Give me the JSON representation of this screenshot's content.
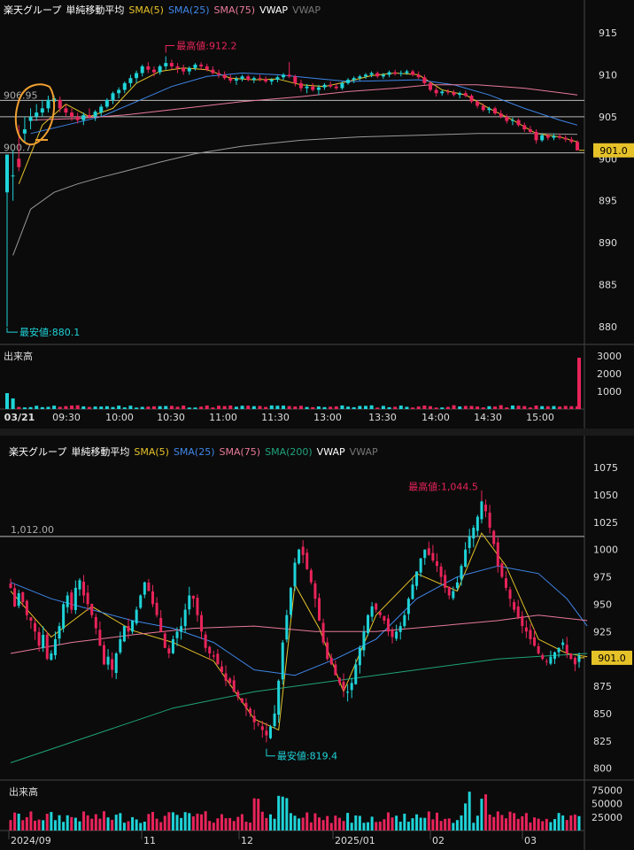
{
  "colors": {
    "sma5": "#e6c229",
    "sma25": "#3f86e8",
    "sma75": "#e87a9a",
    "sma200": "#1fa37a",
    "vwap": "#dddddd",
    "vwap_muted": "#777777",
    "up": "#1fd3d8",
    "down": "#e8245a",
    "price_box": "#e6c229",
    "annot": "#e8245a",
    "annot_low": "#1fd3d8",
    "circle": "#f0a030"
  },
  "intraday": {
    "legend": {
      "name": "楽天グループ",
      "avg": "単純移動平均",
      "sma5": "SMA(5)",
      "sma25": "SMA(25)",
      "sma75": "SMA(75)",
      "vwap": "VWAP",
      "vwap2": "VWAP"
    },
    "volume_title": "出来高",
    "high_label": "最高値:912.2",
    "low_label": "最安値:880.1",
    "ref1_label": "906.95",
    "ref2_label": "900.7",
    "price_label": "901.0"
  },
  "daily": {
    "legend": {
      "name": "楽天グループ",
      "avg": "単純移動平均",
      "sma5": "SMA(5)",
      "sma25": "SMA(25)",
      "sma75": "SMA(75)",
      "sma200": "SMA(200)",
      "vwap": "VWAP",
      "vwap2": "VWAP"
    },
    "volume_title": "出来高",
    "high_label": "最高値:1,044.5",
    "low_label": "最安値:819.4",
    "ref_label": "1,012.00",
    "price_label": "901.0"
  },
  "chart_data": [
    {
      "type": "candlestick",
      "title": "楽天グループ",
      "period": "intraday 03/21",
      "x_ticks": [
        "03/21",
        "09:30",
        "10:00",
        "10:30",
        "11:00",
        "11:30",
        "13:00",
        "13:30",
        "14:00",
        "14:30",
        "15:00"
      ],
      "y_ticks": [
        880,
        885,
        890,
        895,
        900,
        905,
        910,
        915
      ],
      "ylim": [
        878,
        917
      ],
      "volume_ticks": [
        1000,
        2000,
        3000
      ],
      "volume_ylim": [
        0,
        3300
      ],
      "last_price": 901.0,
      "high": 912.2,
      "low": 880.1,
      "ref_lines": [
        906.95,
        905.0,
        900.7
      ],
      "candles": [
        [
          0,
          896,
          898,
          880,
          900.5
        ],
        [
          1,
          898,
          901,
          895,
          898
        ],
        [
          2,
          900,
          904,
          898.5,
          899
        ],
        [
          3,
          903,
          905,
          902,
          903.5
        ],
        [
          4,
          904.5,
          906,
          903.5,
          905
        ],
        [
          5,
          905,
          906.5,
          904.5,
          905.5
        ],
        [
          6,
          905.5,
          907,
          905,
          906
        ],
        [
          7,
          906,
          907.5,
          905.5,
          907
        ],
        [
          8,
          906.8,
          907.5,
          906,
          907.2
        ],
        [
          9,
          907,
          907.4,
          905.5,
          906
        ],
        [
          10,
          906,
          906.5,
          905,
          905.5
        ],
        [
          11,
          905.5,
          906,
          904.5,
          905
        ],
        [
          12,
          905,
          905.5,
          904.2,
          904.6
        ],
        [
          13,
          904.6,
          905.5,
          904,
          905.2
        ],
        [
          14,
          905.2,
          906,
          904.8,
          905
        ],
        [
          15,
          905,
          905.8,
          904.5,
          905.6
        ],
        [
          16,
          905.5,
          906.5,
          905,
          906.2
        ],
        [
          17,
          906.2,
          907.2,
          906,
          907
        ],
        [
          18,
          907,
          908,
          906.5,
          907.8
        ],
        [
          19,
          907.8,
          908.5,
          907.2,
          908.2
        ],
        [
          20,
          908.2,
          909.2,
          907.8,
          909
        ],
        [
          21,
          909,
          910,
          908.5,
          909.6
        ],
        [
          22,
          909.6,
          910.5,
          909,
          910.2
        ],
        [
          23,
          910.2,
          911.2,
          909.8,
          911
        ],
        [
          24,
          911,
          911.5,
          910.2,
          910.6
        ],
        [
          25,
          910.6,
          911,
          909.8,
          910.3
        ],
        [
          26,
          910.3,
          911.2,
          910,
          911
        ],
        [
          27,
          911,
          912.2,
          910.6,
          911.4
        ],
        [
          28,
          911.4,
          911.8,
          910.6,
          911
        ],
        [
          29,
          911,
          911.4,
          910.2,
          910.8
        ],
        [
          30,
          910.8,
          911.2,
          910,
          910.4
        ],
        [
          31,
          910.4,
          911,
          910,
          910.8
        ],
        [
          32,
          910.8,
          911.4,
          910.5,
          911.2
        ],
        [
          33,
          911.2,
          911.5,
          910.6,
          911
        ],
        [
          34,
          911,
          911.3,
          910.4,
          910.6
        ],
        [
          35,
          910.6,
          911,
          910,
          910.2
        ],
        [
          36,
          910.2,
          910.6,
          909.6,
          910
        ],
        [
          37,
          910,
          910.4,
          909.4,
          909.6
        ],
        [
          38,
          909.6,
          910,
          909,
          909.3
        ],
        [
          39,
          909.3,
          909.8,
          908.8,
          909.5
        ],
        [
          40,
          909.5,
          910,
          909.2,
          909.8
        ],
        [
          41,
          909.8,
          910,
          909.2,
          909.4
        ],
        [
          42,
          909.4,
          909.8,
          909,
          909.6
        ],
        [
          43,
          909.6,
          910,
          909.2,
          909.5
        ],
        [
          44,
          909.5,
          909.8,
          909,
          909.2
        ],
        [
          45,
          909.2,
          909.6,
          908.8,
          909.4
        ],
        [
          46,
          909.4,
          909.9,
          909.1,
          909.7
        ],
        [
          47,
          909.7,
          910.2,
          909.4,
          910
        ],
        [
          48,
          910,
          911.5,
          909.6,
          909.8
        ],
        [
          49,
          909.8,
          910,
          908.6,
          909
        ],
        [
          50,
          909,
          909.4,
          908,
          908.4
        ],
        [
          51,
          908.4,
          908.9,
          907.8,
          908.6
        ],
        [
          52,
          908.6,
          909,
          908,
          908.2
        ],
        [
          53,
          908.2,
          908.8,
          907.6,
          908.5
        ],
        [
          54,
          908.5,
          909,
          908.2,
          908.8
        ],
        [
          55,
          908.8,
          909.2,
          908.4,
          908.6
        ],
        [
          56,
          908.6,
          909,
          908.2,
          908.4
        ],
        [
          57,
          908.4,
          909.2,
          908.2,
          909
        ],
        [
          58,
          909,
          909.6,
          908.8,
          909.4
        ],
        [
          59,
          909.4,
          909.8,
          909,
          909.6
        ],
        [
          60,
          909.6,
          910,
          909.3,
          909.8
        ],
        [
          61,
          909.8,
          910.2,
          909.5,
          910
        ],
        [
          62,
          910,
          910.4,
          909.7,
          910.2
        ],
        [
          63,
          910.2,
          910.4,
          909.6,
          909.8
        ],
        [
          64,
          909.8,
          910.2,
          909.5,
          910
        ],
        [
          65,
          910,
          910.5,
          909.7,
          910.3
        ],
        [
          66,
          910.3,
          910.6,
          909.9,
          910.1
        ],
        [
          67,
          910.1,
          910.5,
          909.8,
          910.2
        ],
        [
          68,
          910.2,
          910.6,
          910,
          910.4
        ],
        [
          69,
          910.4,
          910.6,
          909.8,
          910
        ],
        [
          70,
          910,
          910.4,
          909.5,
          909.7
        ],
        [
          71,
          909.7,
          910,
          908.8,
          909
        ],
        [
          72,
          909,
          909.2,
          908,
          908.2
        ],
        [
          73,
          908.2,
          908.5,
          907.4,
          907.8
        ],
        [
          74,
          907.8,
          908.2,
          907.5,
          908
        ],
        [
          75,
          908,
          908.3,
          907.6,
          907.9
        ],
        [
          76,
          907.9,
          908.2,
          907.4,
          907.6
        ],
        [
          77,
          907.6,
          908,
          907.2,
          907.8
        ],
        [
          78,
          907.8,
          908.1,
          907.3,
          907.5
        ],
        [
          79,
          907.5,
          907.7,
          906.6,
          906.8
        ],
        [
          80,
          906.8,
          907,
          906,
          906.3
        ],
        [
          81,
          906.3,
          906.6,
          905.6,
          905.8
        ],
        [
          82,
          905.8,
          906.2,
          905.4,
          906
        ],
        [
          83,
          906,
          906.2,
          905.2,
          905.4
        ],
        [
          84,
          905.4,
          905.8,
          904.8,
          905
        ],
        [
          85,
          905,
          905.3,
          904.2,
          904.5
        ],
        [
          86,
          904.5,
          904.9,
          904,
          904.6
        ],
        [
          87,
          904.6,
          904.8,
          903.8,
          904
        ],
        [
          88,
          904,
          904.3,
          903.2,
          903.5
        ],
        [
          89,
          903.5,
          903.9,
          903,
          903.2
        ],
        [
          90,
          903.2,
          903.5,
          901.8,
          902.2
        ],
        [
          91,
          902.2,
          903,
          902,
          902.8
        ],
        [
          92,
          902.8,
          903,
          902.2,
          902.5
        ],
        [
          93,
          902.5,
          903,
          902.2,
          902.7
        ],
        [
          94,
          902.7,
          903,
          902.3,
          902.5
        ],
        [
          95,
          902.5,
          902.8,
          902,
          902.3
        ],
        [
          96,
          902.3,
          902.6,
          901.8,
          902
        ],
        [
          97,
          902,
          902.2,
          901,
          901
        ]
      ],
      "series": [
        {
          "name": "SMA(5)",
          "x": [
            2,
            6,
            10,
            14,
            18,
            22,
            26,
            30,
            34,
            38,
            42,
            46,
            50,
            54,
            58,
            62,
            66,
            70,
            74,
            78,
            82,
            86,
            90,
            94,
            97
          ],
          "values": [
            897,
            904,
            906.5,
            905,
            906,
            909,
            910.4,
            910.8,
            910.6,
            909.6,
            909.4,
            909.5,
            908.8,
            908.6,
            909.2,
            909.9,
            910.2,
            910,
            908.2,
            907.6,
            906,
            904.6,
            903,
            902.6,
            902
          ]
        },
        {
          "name": "SMA(25)",
          "x": [
            4,
            10,
            16,
            22,
            28,
            34,
            40,
            46,
            52,
            58,
            64,
            70,
            76,
            82,
            88,
            94,
            97
          ],
          "values": [
            903,
            904,
            905,
            906.8,
            908.6,
            909.8,
            910.2,
            910,
            909.6,
            909.2,
            909.3,
            909.4,
            908.8,
            907.6,
            906,
            904.6,
            904
          ]
        },
        {
          "name": "SMA(75)",
          "x": [
            4,
            12,
            20,
            30,
            40,
            50,
            58,
            66,
            72,
            80,
            88,
            97
          ],
          "values": [
            904.6,
            904.8,
            905.2,
            906,
            906.8,
            907.4,
            908,
            908.4,
            908.8,
            908.8,
            908.4,
            907.6
          ]
        },
        {
          "name": "VWAP",
          "x": [
            1,
            4,
            8,
            12,
            16,
            20,
            26,
            32,
            40,
            50,
            60,
            70,
            80,
            90,
            97
          ],
          "values": [
            888.5,
            894,
            896,
            897,
            897.8,
            898.5,
            899.6,
            900.6,
            901.5,
            902.2,
            902.6,
            902.8,
            903,
            903,
            902.9
          ]
        }
      ],
      "volume_end_spike": 2900
    },
    {
      "type": "candlestick",
      "title": "楽天グループ",
      "period": "daily",
      "x_ticks": [
        "2024/09",
        "11",
        "12",
        "2025/01",
        "02",
        "03"
      ],
      "y_ticks": [
        800,
        825,
        850,
        875,
        900,
        925,
        950,
        975,
        1000,
        1025,
        1050,
        1075
      ],
      "ylim": [
        790,
        1088
      ],
      "volume_ticks": [
        25000,
        50000,
        75000
      ],
      "volume_ylim": [
        0,
        82000
      ],
      "last_price": 901.0,
      "high": 1044.5,
      "low": 819.4,
      "ref_lines": [
        1012.0
      ],
      "closes": [
        965,
        948,
        960,
        952,
        940,
        935,
        925,
        912,
        922,
        900,
        905,
        918,
        930,
        950,
        958,
        945,
        965,
        972,
        958,
        950,
        940,
        928,
        912,
        895,
        902,
        890,
        905,
        918,
        930,
        925,
        935,
        945,
        958,
        970,
        962,
        950,
        940,
        925,
        910,
        905,
        918,
        925,
        930,
        945,
        958,
        955,
        940,
        925,
        910,
        905,
        902,
        895,
        888,
        880,
        878,
        870,
        865,
        860,
        855,
        850,
        842,
        840,
        835,
        830,
        838,
        850,
        880,
        915,
        940,
        965,
        988,
        1000,
        995,
        982,
        970,
        955,
        935,
        915,
        900,
        895,
        885,
        878,
        872,
        870,
        878,
        895,
        910,
        925,
        940,
        948,
        945,
        940,
        935,
        925,
        920,
        925,
        930,
        940,
        955,
        968,
        980,
        992,
        1000,
        995,
        990,
        985,
        975,
        965,
        958,
        962,
        970,
        985,
        1000,
        1012,
        1020,
        1030,
        1044,
        1035,
        1020,
        1005,
        985,
        975,
        965,
        955,
        945,
        938,
        930,
        925,
        918,
        912,
        905,
        900,
        898,
        902,
        906,
        910,
        915,
        905,
        900,
        895,
        903
      ],
      "series": [
        {
          "name": "SMA(5)",
          "x": [
            0,
            10,
            20,
            30,
            40,
            50,
            60,
            66,
            70,
            76,
            82,
            90,
            100,
            110,
            116,
            122,
            130,
            137,
            142
          ],
          "values": [
            962,
            920,
            948,
            926,
            915,
            898,
            845,
            835,
            968,
            928,
            870,
            940,
            978,
            962,
            1015,
            985,
            918,
            905,
            902
          ]
        },
        {
          "name": "SMA(25)",
          "x": [
            0,
            10,
            20,
            30,
            40,
            50,
            60,
            70,
            80,
            90,
            100,
            110,
            120,
            130,
            137,
            142
          ],
          "values": [
            970,
            955,
            945,
            935,
            928,
            915,
            890,
            885,
            900,
            918,
            955,
            975,
            985,
            978,
            955,
            930
          ]
        },
        {
          "name": "SMA(75)",
          "x": [
            0,
            15,
            30,
            45,
            60,
            75,
            90,
            105,
            120,
            130,
            142
          ],
          "values": [
            905,
            915,
            922,
            928,
            930,
            925,
            925,
            930,
            935,
            940,
            935
          ]
        },
        {
          "name": "SMA(200)",
          "x": [
            0,
            20,
            40,
            60,
            80,
            100,
            120,
            142
          ],
          "values": [
            805,
            830,
            855,
            870,
            880,
            890,
            900,
            905
          ]
        }
      ]
    }
  ]
}
